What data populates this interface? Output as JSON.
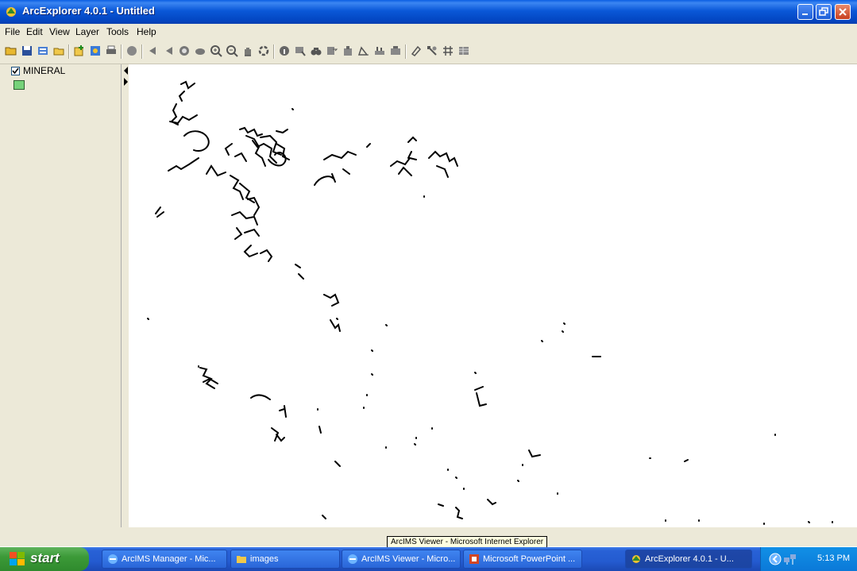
{
  "window": {
    "title": "ArcExplorer 4.0.1 - Untitled"
  },
  "menu": {
    "items": [
      "File",
      "Edit",
      "View",
      "Layer",
      "Tools",
      "Help"
    ]
  },
  "toolbar": {
    "icons": [
      "open-icon",
      "save-icon",
      "add-layer-icon",
      "folder-icon",
      "add-data-icon",
      "catalog-icon",
      "print-icon",
      "globe-icon",
      "back-icon",
      "forward-icon",
      "full-extent-icon",
      "extent-icon",
      "zoom-in-icon",
      "zoom-out-icon",
      "pan-icon",
      "refresh-icon",
      "identify-icon",
      "select-icon",
      "find-icon",
      "measure-icon",
      "query-icon",
      "buffer-icon",
      "attribute-icon",
      "properties-icon",
      "eraser-icon",
      "label-icon",
      "grid-icon",
      "table-icon"
    ]
  },
  "legend": {
    "layer_name": "MINERAL",
    "checked": true,
    "swatch_color": "#76d27a"
  },
  "tooltip": {
    "text": "ArcIMS Viewer - Microsoft Internet Explorer"
  },
  "taskbar": {
    "start_label": "start",
    "buttons": [
      {
        "label": "ArcIMS Manager - Mic..."
      },
      {
        "label": "images"
      },
      {
        "label": "ArcIMS Viewer - Micro..."
      },
      {
        "label": "Microsoft PowerPoint ..."
      },
      {
        "label": "ArcExplorer 4.0.1 - U..."
      }
    ],
    "clock": "5:13 PM"
  }
}
